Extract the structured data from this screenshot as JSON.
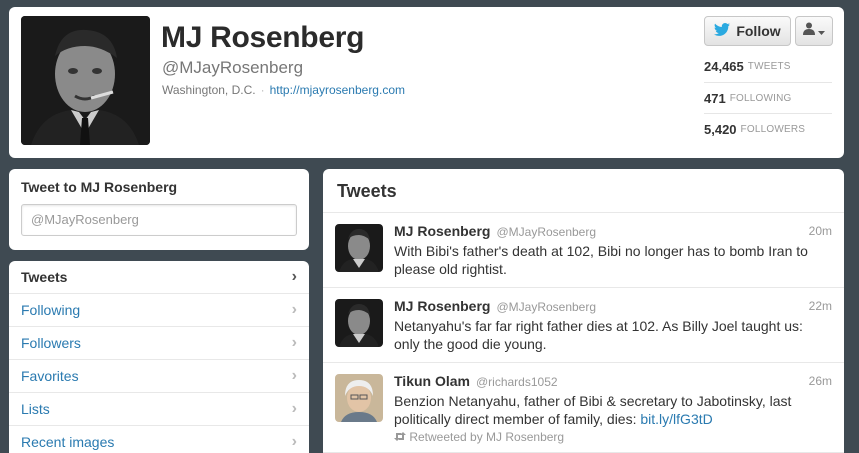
{
  "profile": {
    "name": "MJ Rosenberg",
    "handle": "@MJayRosenberg",
    "location": "Washington, D.C.",
    "separator": "·",
    "url": "http://mjayrosenberg.com",
    "follow_label": "Follow",
    "stats": [
      {
        "value": "24,465",
        "label": "TWEETS"
      },
      {
        "value": "471",
        "label": "FOLLOWING"
      },
      {
        "value": "5,420",
        "label": "FOLLOWERS"
      }
    ]
  },
  "tweet_to": {
    "title": "Tweet to MJ Rosenberg",
    "placeholder": "@MJayRosenberg"
  },
  "nav": {
    "items": [
      {
        "label": "Tweets"
      },
      {
        "label": "Following"
      },
      {
        "label": "Followers"
      },
      {
        "label": "Favorites"
      },
      {
        "label": "Lists"
      },
      {
        "label": "Recent images"
      }
    ],
    "chevron": "›"
  },
  "stream": {
    "title": "Tweets",
    "tweets": [
      {
        "name": "MJ Rosenberg",
        "screen_name": "@MJayRosenberg",
        "time": "20m",
        "text": "With Bibi's father's death at 102, Bibi no longer has to bomb Iran to please old rightist."
      },
      {
        "name": "MJ Rosenberg",
        "screen_name": "@MJayRosenberg",
        "time": "22m",
        "text": "Netanyahu's far far right father dies at 102. As Billy Joel taught us: only the good die young."
      },
      {
        "name": "Tikun Olam",
        "screen_name": "@richards1052",
        "time": "26m",
        "text": "Benzion Netanyahu, father of Bibi & secretary to Jabotinsky, last politically direct member of family, dies: ",
        "link": "bit.ly/lfG3tD",
        "retweet": "Retweeted by MJ Rosenberg"
      }
    ]
  },
  "colors": {
    "background": "#3f4a52",
    "link": "#2a7ab0",
    "twitter_bird": "#2aa9e0"
  },
  "icons": {
    "follow": "twitter-bird-icon",
    "user_menu": "user-icon",
    "retweet": "retweet-icon"
  }
}
